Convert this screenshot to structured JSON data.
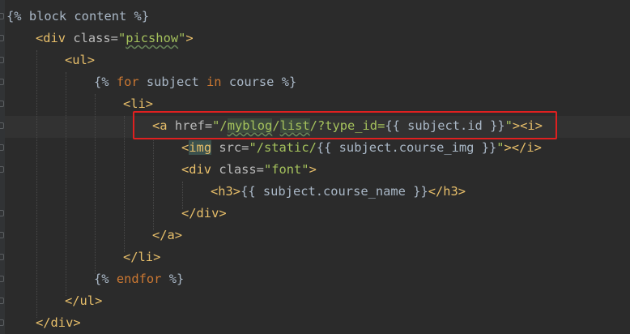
{
  "editor": {
    "lines": [
      {
        "text": "{% block content %}"
      },
      {
        "text": "<div class=\"picshow\">"
      },
      {
        "text": "<ul>"
      },
      {
        "text": "{% for subject in course %}"
      },
      {
        "text": "<li>"
      },
      {
        "text": "<a href=\"/myblog/list/?type_id={{ subject.id }}\"><i>"
      },
      {
        "text": "<img src=\"/static/{{ subject.course_img }}\"></i>"
      },
      {
        "text": "<div class=\"font\">"
      },
      {
        "text": "<h3>{{ subject.course_name }}</h3>"
      },
      {
        "text": "</div>"
      },
      {
        "text": "</a>"
      },
      {
        "text": "</li>"
      },
      {
        "text": "{% endfor %}"
      },
      {
        "text": "</ul>"
      },
      {
        "text": "</div>"
      }
    ],
    "highlight_box_color": "#e02020",
    "background_color": "#2b2b2b"
  }
}
